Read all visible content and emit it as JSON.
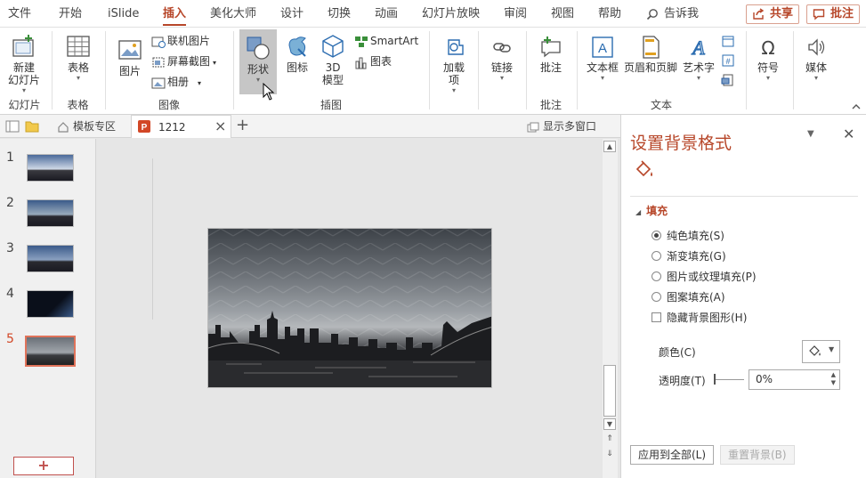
{
  "menu": {
    "items": [
      "文件",
      "开始",
      "iSlide",
      "插入",
      "美化大师",
      "设计",
      "切换",
      "动画",
      "幻灯片放映",
      "审阅",
      "视图",
      "帮助"
    ],
    "tellme": "告诉我",
    "share": "共享",
    "comment": "批注"
  },
  "ribbon": {
    "new_slide": "新建\n幻灯片",
    "slides_group": "幻灯片",
    "table": "表格",
    "table_group": "表格",
    "picture": "图片",
    "online_pictures": "联机图片",
    "screenshot": "屏幕截图",
    "album": "相册",
    "images_group": "图像",
    "shapes": "形状",
    "icons": "图标",
    "model3d": "3D\n模型",
    "smartart": "SmartArt",
    "chart": "图表",
    "illustrations_group": "插图",
    "addins": "加载\n项",
    "link": "链接",
    "comment": "批注",
    "comments_group": "批注",
    "textbox": "文本框",
    "header_footer": "页眉和页脚",
    "wordart": "艺术字",
    "text_group": "文本",
    "symbols": "符号",
    "media": "媒体"
  },
  "tabbar": {
    "template_zone": "模板专区",
    "doc_name": "1212",
    "show_multi": "显示多窗口"
  },
  "slides": [
    "1",
    "2",
    "3",
    "4",
    "5"
  ],
  "active_slide": 5,
  "pane": {
    "title": "设置背景格式",
    "section": "填充",
    "fill_options": [
      "纯色填充(S)",
      "渐变填充(G)",
      "图片或纹理填充(P)",
      "图案填充(A)"
    ],
    "selected_fill": 0,
    "hide_bg": "隐藏背景图形(H)",
    "color_label": "颜色(C)",
    "transparency_label": "透明度(T)",
    "transparency_value": "0%",
    "apply_all": "应用到全部(L)",
    "reset_bg": "重置背景(B)"
  },
  "colors": {
    "accent": "#b7472a"
  }
}
